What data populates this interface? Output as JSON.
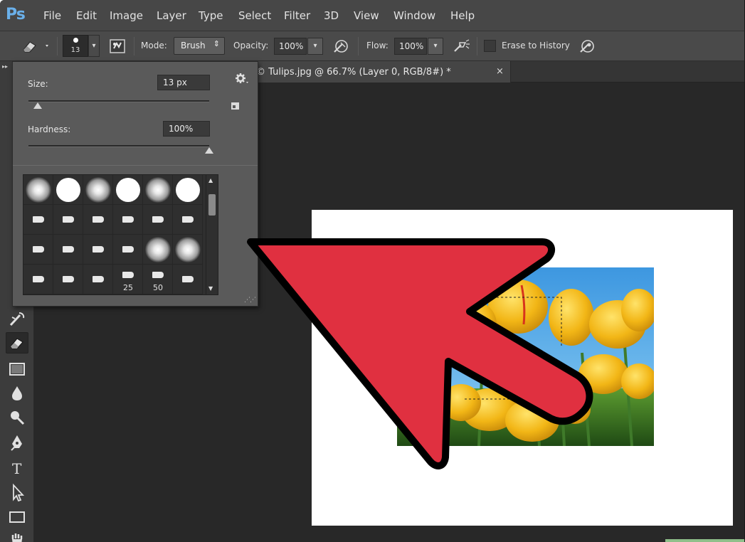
{
  "app": {
    "logo": "Ps",
    "menu": [
      "File",
      "Edit",
      "Image",
      "Layer",
      "Type",
      "Select",
      "Filter",
      "3D",
      "View",
      "Window",
      "Help"
    ]
  },
  "options_bar": {
    "brush_size_value": "13",
    "mode_label": "Mode:",
    "mode_value": "Brush",
    "opacity_label": "Opacity:",
    "opacity_value": "100%",
    "flow_label": "Flow:",
    "flow_value": "100%",
    "erase_to_history_label": "Erase to History",
    "erase_to_history_checked": false
  },
  "document_tab": {
    "title": "© Tulips.jpg @ 66.7% (Layer 0, RGB/8#) *",
    "close_glyph": "×"
  },
  "brush_picker": {
    "size_label": "Size:",
    "size_value": "13 px",
    "size_fraction": 0.05,
    "hardness_label": "Hardness:",
    "hardness_value": "100%",
    "hardness_fraction": 1.0,
    "presets": [
      {
        "kind": "soft"
      },
      {
        "kind": "hard"
      },
      {
        "kind": "soft"
      },
      {
        "kind": "hard"
      },
      {
        "kind": "soft"
      },
      {
        "kind": "hard"
      },
      {
        "kind": "tip"
      },
      {
        "kind": "tip"
      },
      {
        "kind": "tip"
      },
      {
        "kind": "tip"
      },
      {
        "kind": "tip"
      },
      {
        "kind": "tip"
      },
      {
        "kind": "tip"
      },
      {
        "kind": "tip"
      },
      {
        "kind": "tip"
      },
      {
        "kind": "tip"
      },
      {
        "kind": "soft"
      },
      {
        "kind": "soft"
      },
      {
        "kind": "tip"
      },
      {
        "kind": "tip"
      },
      {
        "kind": "tip"
      },
      {
        "kind": "tip",
        "label": "25"
      },
      {
        "kind": "tip",
        "label": "50"
      },
      {
        "kind": "tip"
      }
    ]
  },
  "colors": {
    "arrow_fill": "#e03040",
    "arrow_stroke": "#000000",
    "sky": "#4aa3e0",
    "tulip": "#f0c020",
    "stem": "#3f7a2a"
  },
  "icons": {
    "eraser_tool": "eraser-icon",
    "gear": "gear-icon",
    "airbrush": "airbrush-icon",
    "pressure": "pressure-icon"
  }
}
